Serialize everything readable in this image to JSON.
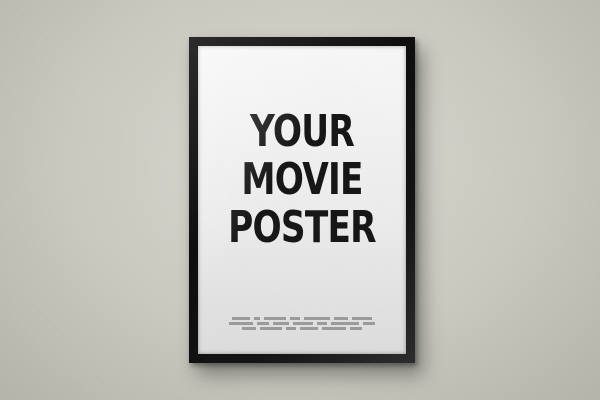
{
  "poster": {
    "title_lines": [
      "YOUR",
      "MOVIE",
      "POSTER"
    ],
    "credits_lines": [
      "",
      "",
      ""
    ]
  },
  "colors": {
    "wall": "#c9c9c0",
    "frame": "#111111",
    "poster_paper": "#ececec",
    "title_text": "#141414"
  }
}
